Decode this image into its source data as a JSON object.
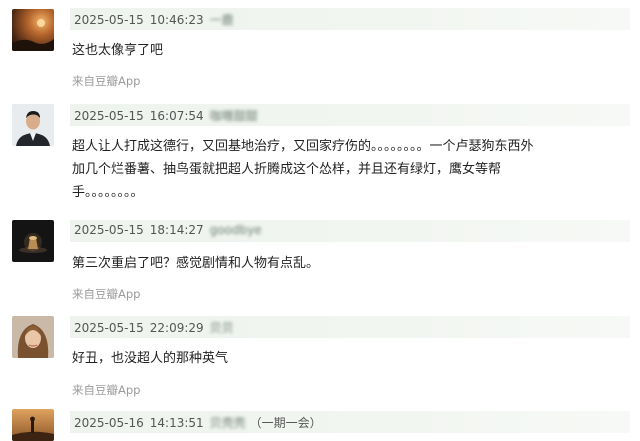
{
  "comments": [
    {
      "date": "2025-05-15",
      "time": "10:46:23",
      "user": "一鹿",
      "user_clear": "",
      "text": "这也太像亨了吧",
      "source": "来自豆瓣App",
      "avatar_icon": "sunset-sky-avatar-icon"
    },
    {
      "date": "2025-05-15",
      "time": "16:07:54",
      "user": "咖喱甜甜",
      "user_clear": "",
      "text": "超人让人打成这德行，又回基地治疗，又回家疗伤的。。。。。。。。一个卢瑟狗东西外加几个烂番薯、抽鸟蛋就把超人折腾成这个怂样，并且还有绿灯，鹰女等帮手。。。。。。。。",
      "source": "",
      "avatar_icon": "man-in-suit-avatar-icon"
    },
    {
      "date": "2025-05-15",
      "time": "18:14:27",
      "user": "goodbye",
      "user_clear": "",
      "text": "第三次重启了吧？感觉剧情和人物有点乱。",
      "source": "来自豆瓣App",
      "avatar_icon": "dark-lamp-avatar-icon"
    },
    {
      "date": "2025-05-15",
      "time": "22:09:29",
      "user": "贝贝",
      "user_clear": "",
      "text": "好丑，也没超人的那种英气",
      "source": "来自豆瓣App",
      "avatar_icon": "woman-portrait-avatar-icon"
    },
    {
      "date": "2025-05-16",
      "time": "14:13:51",
      "user": "贝壳壳",
      "user_clear": "（一期一会）",
      "text": "",
      "source": "",
      "avatar_icon": "silhouette-sunset-avatar-icon"
    }
  ]
}
